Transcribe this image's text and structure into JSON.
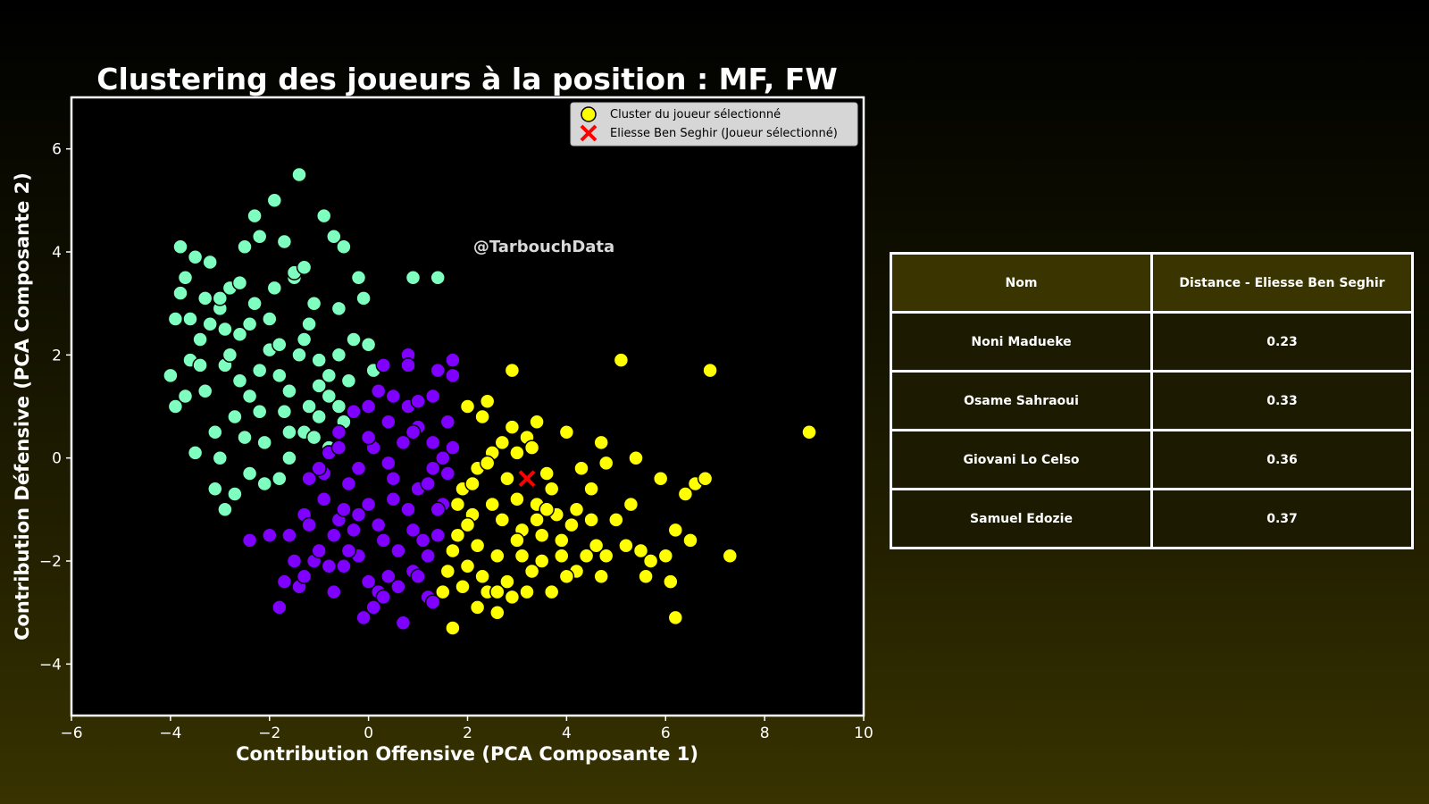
{
  "chart_data": {
    "type": "scatter",
    "title": "Clustering des joueurs à la position : MF, FW",
    "xlabel": "Contribution Offensive (PCA Composante 1)",
    "ylabel": "Contribution Défensive (PCA Composante 2)",
    "xlim": [
      -6,
      10
    ],
    "ylim": [
      -5,
      7
    ],
    "xticks": [
      -6,
      -4,
      -2,
      0,
      2,
      4,
      6,
      8,
      10
    ],
    "yticks": [
      -4,
      -2,
      0,
      2,
      4,
      6
    ],
    "xtick_labels": [
      "−6",
      "−4",
      "−2",
      "0",
      "2",
      "4",
      "6",
      "8",
      "10"
    ],
    "ytick_labels": [
      "−4",
      "−2",
      "0",
      "2",
      "4",
      "6"
    ],
    "grid": false,
    "legend_position": "top-right",
    "watermark": "@TarbouchData",
    "legend": [
      {
        "label": "Cluster du joueur sélectionné",
        "marker": "circle",
        "color": "#ffff00"
      },
      {
        "label": "Eliesse Ben Seghir (Joueur sélectionné)",
        "marker": "x",
        "color": "#ff0000"
      }
    ],
    "series": [
      {
        "color": "#7fffbf",
        "points": [
          [
            -3.9,
            2.7
          ],
          [
            -3.8,
            4.1
          ],
          [
            -3.7,
            3.5
          ],
          [
            -3.6,
            1.9
          ],
          [
            -3.5,
            3.9
          ],
          [
            -3.4,
            2.3
          ],
          [
            -3.3,
            1.3
          ],
          [
            -3.2,
            3.8
          ],
          [
            -3.1,
            0.5
          ],
          [
            -3.0,
            2.9
          ],
          [
            -2.9,
            1.8
          ],
          [
            -2.8,
            3.3
          ],
          [
            -2.7,
            0.8
          ],
          [
            -2.6,
            2.4
          ],
          [
            -2.5,
            4.1
          ],
          [
            -2.4,
            1.2
          ],
          [
            -2.3,
            3.0
          ],
          [
            -2.2,
            4.3
          ],
          [
            -2.1,
            0.3
          ],
          [
            -2.0,
            2.1
          ],
          [
            -1.9,
            5.0
          ],
          [
            -1.8,
            1.6
          ],
          [
            -1.7,
            4.2
          ],
          [
            -1.6,
            0.5
          ],
          [
            -1.5,
            3.5
          ],
          [
            -1.4,
            5.5
          ],
          [
            -1.3,
            2.3
          ],
          [
            -1.2,
            1.0
          ],
          [
            -1.1,
            3.0
          ],
          [
            -1.0,
            1.9
          ],
          [
            -0.9,
            4.7
          ],
          [
            -0.8,
            0.2
          ],
          [
            -0.7,
            4.3
          ],
          [
            -0.6,
            2.9
          ],
          [
            -0.5,
            4.1
          ],
          [
            -0.4,
            1.5
          ],
          [
            -0.3,
            2.3
          ],
          [
            -0.2,
            3.5
          ],
          [
            -0.1,
            3.1
          ],
          [
            0.0,
            2.2
          ],
          [
            0.1,
            1.7
          ],
          [
            -3.9,
            1.0
          ],
          [
            -4.0,
            1.6
          ],
          [
            -3.7,
            1.2
          ],
          [
            -3.5,
            0.1
          ],
          [
            -3.0,
            0.0
          ],
          [
            -2.9,
            -1.0
          ],
          [
            -3.1,
            -0.6
          ],
          [
            -2.7,
            -0.7
          ],
          [
            -2.4,
            -0.3
          ],
          [
            -2.1,
            -0.5
          ],
          [
            -1.8,
            -0.4
          ],
          [
            -1.6,
            0.0
          ],
          [
            -1.3,
            0.5
          ],
          [
            -1.0,
            0.8
          ],
          [
            -0.8,
            1.2
          ],
          [
            -0.5,
            0.7
          ],
          [
            -3.4,
            1.8
          ],
          [
            -3.2,
            2.6
          ],
          [
            -3.0,
            3.1
          ],
          [
            -2.8,
            2.0
          ],
          [
            -2.6,
            1.5
          ],
          [
            -2.4,
            2.6
          ],
          [
            -2.2,
            1.7
          ],
          [
            -2.0,
            2.7
          ],
          [
            -1.8,
            2.2
          ],
          [
            -1.6,
            1.3
          ],
          [
            -1.4,
            2.0
          ],
          [
            -1.2,
            2.6
          ],
          [
            -1.0,
            1.4
          ],
          [
            -0.8,
            1.6
          ],
          [
            -0.6,
            2.0
          ],
          [
            -2.3,
            4.7
          ],
          [
            -1.9,
            3.3
          ],
          [
            -1.5,
            3.6
          ],
          [
            -1.3,
            3.7
          ],
          [
            0.9,
            3.5
          ],
          [
            1.4,
            3.5
          ],
          [
            -0.6,
            1.0
          ],
          [
            -1.1,
            0.4
          ],
          [
            -3.6,
            2.7
          ],
          [
            -3.3,
            3.1
          ],
          [
            -2.9,
            2.5
          ],
          [
            -2.5,
            0.4
          ],
          [
            -2.2,
            0.9
          ],
          [
            -1.7,
            0.9
          ],
          [
            -3.8,
            3.2
          ],
          [
            -2.6,
            3.4
          ]
        ]
      },
      {
        "color": "#7f00ff",
        "points": [
          [
            -2.4,
            -1.6
          ],
          [
            -2.0,
            -1.5
          ],
          [
            -1.8,
            -2.9
          ],
          [
            -1.7,
            -2.4
          ],
          [
            -1.5,
            -2.0
          ],
          [
            -1.4,
            -2.5
          ],
          [
            -1.3,
            -1.1
          ],
          [
            -1.2,
            -0.4
          ],
          [
            -1.1,
            -2.0
          ],
          [
            -1.0,
            -1.8
          ],
          [
            -0.9,
            -0.8
          ],
          [
            -0.8,
            0.1
          ],
          [
            -0.7,
            -2.6
          ],
          [
            -0.6,
            -1.2
          ],
          [
            -0.5,
            -2.1
          ],
          [
            -0.4,
            -0.5
          ],
          [
            -0.3,
            -1.4
          ],
          [
            -0.2,
            -1.9
          ],
          [
            -0.1,
            -3.1
          ],
          [
            0.0,
            -0.9
          ],
          [
            0.1,
            -2.9
          ],
          [
            0.2,
            -2.6
          ],
          [
            0.3,
            -1.6
          ],
          [
            0.4,
            -2.3
          ],
          [
            0.5,
            -0.4
          ],
          [
            0.6,
            -1.8
          ],
          [
            0.7,
            -3.2
          ],
          [
            0.8,
            -1.0
          ],
          [
            0.9,
            -2.2
          ],
          [
            1.0,
            -0.6
          ],
          [
            1.1,
            -1.6
          ],
          [
            1.2,
            -2.7
          ],
          [
            1.3,
            -0.2
          ],
          [
            1.4,
            -1.5
          ],
          [
            1.5,
            -0.9
          ],
          [
            -0.6,
            0.5
          ],
          [
            -0.3,
            0.9
          ],
          [
            0.0,
            1.0
          ],
          [
            0.2,
            1.3
          ],
          [
            0.5,
            1.2
          ],
          [
            0.8,
            1.0
          ],
          [
            1.0,
            1.1
          ],
          [
            1.3,
            1.2
          ],
          [
            0.8,
            2.0
          ],
          [
            0.8,
            1.8
          ],
          [
            1.4,
            1.7
          ],
          [
            1.7,
            1.9
          ],
          [
            1.7,
            1.6
          ],
          [
            0.3,
            1.8
          ],
          [
            1.6,
            0.7
          ],
          [
            1.7,
            0.2
          ],
          [
            1.5,
            0.0
          ],
          [
            -1.6,
            -1.5
          ],
          [
            -1.2,
            -1.3
          ],
          [
            -0.9,
            -0.3
          ],
          [
            -0.5,
            -1.0
          ],
          [
            -0.2,
            -0.2
          ],
          [
            0.1,
            0.2
          ],
          [
            0.4,
            -0.1
          ],
          [
            0.7,
            0.3
          ],
          [
            1.0,
            0.6
          ],
          [
            1.2,
            -0.5
          ],
          [
            1.4,
            -1.0
          ],
          [
            -1.3,
            -2.3
          ],
          [
            -0.8,
            -2.1
          ],
          [
            -0.4,
            -1.8
          ],
          [
            0.0,
            -2.4
          ],
          [
            0.3,
            -2.7
          ],
          [
            0.6,
            -2.5
          ],
          [
            1.0,
            -2.3
          ],
          [
            1.3,
            -2.8
          ],
          [
            -0.7,
            -1.5
          ],
          [
            -0.2,
            -1.1
          ],
          [
            0.2,
            -1.3
          ],
          [
            0.5,
            -0.8
          ],
          [
            0.9,
            -1.4
          ],
          [
            1.2,
            -1.9
          ],
          [
            -1.0,
            -0.2
          ],
          [
            -0.6,
            0.2
          ],
          [
            0.0,
            0.4
          ],
          [
            0.4,
            0.7
          ],
          [
            0.9,
            0.5
          ],
          [
            1.3,
            0.3
          ],
          [
            1.6,
            -0.3
          ]
        ]
      },
      {
        "color": "#ffff00",
        "points": [
          [
            1.5,
            -2.6
          ],
          [
            1.6,
            -2.2
          ],
          [
            1.7,
            -3.3
          ],
          [
            1.8,
            -1.5
          ],
          [
            1.9,
            -0.6
          ],
          [
            2.0,
            -2.1
          ],
          [
            2.0,
            1.0
          ],
          [
            2.1,
            -1.1
          ],
          [
            2.2,
            -0.2
          ],
          [
            2.3,
            0.8
          ],
          [
            2.4,
            1.1
          ],
          [
            2.4,
            -2.6
          ],
          [
            2.5,
            0.1
          ],
          [
            2.6,
            -3.0
          ],
          [
            2.7,
            -1.2
          ],
          [
            2.8,
            -2.4
          ],
          [
            2.9,
            1.7
          ],
          [
            2.9,
            0.6
          ],
          [
            3.0,
            -0.8
          ],
          [
            3.1,
            -1.9
          ],
          [
            3.2,
            0.4
          ],
          [
            3.3,
            -2.2
          ],
          [
            3.4,
            0.7
          ],
          [
            3.5,
            -1.5
          ],
          [
            3.6,
            -0.3
          ],
          [
            3.7,
            -2.6
          ],
          [
            3.8,
            -1.1
          ],
          [
            3.9,
            -1.9
          ],
          [
            4.0,
            0.5
          ],
          [
            4.1,
            -1.3
          ],
          [
            4.2,
            -2.2
          ],
          [
            4.3,
            -0.2
          ],
          [
            4.4,
            -1.9
          ],
          [
            4.5,
            -0.6
          ],
          [
            4.6,
            -1.7
          ],
          [
            4.7,
            -2.3
          ],
          [
            4.8,
            -0.1
          ],
          [
            4.8,
            -1.9
          ],
          [
            5.0,
            -1.2
          ],
          [
            5.1,
            1.9
          ],
          [
            5.2,
            -1.7
          ],
          [
            5.3,
            -0.9
          ],
          [
            5.4,
            0.0
          ],
          [
            5.5,
            -1.8
          ],
          [
            5.6,
            -2.3
          ],
          [
            5.7,
            -2.0
          ],
          [
            5.9,
            -0.4
          ],
          [
            6.0,
            -1.9
          ],
          [
            6.1,
            -2.4
          ],
          [
            6.2,
            -1.4
          ],
          [
            6.2,
            -3.1
          ],
          [
            6.4,
            -0.7
          ],
          [
            6.5,
            -1.6
          ],
          [
            6.6,
            -0.5
          ],
          [
            6.8,
            -0.4
          ],
          [
            6.9,
            1.7
          ],
          [
            7.3,
            -1.9
          ],
          [
            8.9,
            0.5
          ],
          [
            2.2,
            -1.7
          ],
          [
            2.5,
            -0.9
          ],
          [
            2.8,
            -0.4
          ],
          [
            3.1,
            -1.4
          ],
          [
            3.4,
            -0.9
          ],
          [
            3.7,
            -0.6
          ],
          [
            4.0,
            -2.3
          ],
          [
            2.0,
            -1.3
          ],
          [
            2.3,
            -2.3
          ],
          [
            2.6,
            -1.9
          ],
          [
            2.9,
            -2.7
          ],
          [
            3.2,
            -2.6
          ],
          [
            3.5,
            -2.0
          ],
          [
            1.8,
            -0.9
          ],
          [
            2.1,
            -0.5
          ],
          [
            2.4,
            -0.1
          ],
          [
            2.7,
            0.3
          ],
          [
            3.0,
            0.1
          ],
          [
            3.3,
            0.2
          ],
          [
            3.6,
            -1.0
          ],
          [
            3.9,
            -1.6
          ],
          [
            4.2,
            -1.0
          ],
          [
            4.5,
            -1.2
          ],
          [
            1.7,
            -1.8
          ],
          [
            1.9,
            -2.5
          ],
          [
            2.2,
            -2.9
          ],
          [
            2.6,
            -2.6
          ],
          [
            3.0,
            -1.6
          ],
          [
            3.4,
            -1.2
          ],
          [
            4.7,
            0.3
          ]
        ]
      }
    ],
    "selected_player": {
      "name": "Eliesse Ben Seghir",
      "x": 3.2,
      "y": -0.4,
      "color": "#ff0000"
    }
  },
  "table": {
    "headers": [
      "Nom",
      "Distance - Eliesse Ben Seghir"
    ],
    "rows": [
      [
        "Noni Madueke",
        "0.23"
      ],
      [
        "Osame Sahraoui",
        "0.33"
      ],
      [
        "Giovani Lo Celso",
        "0.36"
      ],
      [
        "Samuel Edozie",
        "0.37"
      ]
    ]
  }
}
